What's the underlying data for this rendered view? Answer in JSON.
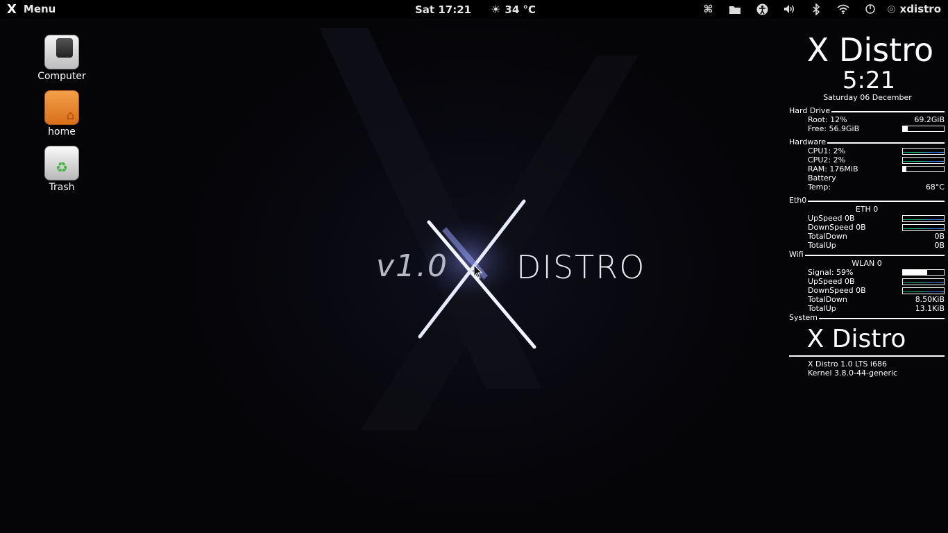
{
  "top_panel": {
    "menu_logo": "X",
    "menu_label": "Menu",
    "clock": "Sat 17:21",
    "weather": "34 °C",
    "user": "xdistro"
  },
  "desktop_icons": [
    {
      "label": "Computer"
    },
    {
      "label": "home"
    },
    {
      "label": "Trash"
    }
  ],
  "wallpaper": {
    "version_text": "v1.0",
    "distro_text": "DISTRO"
  },
  "conky": {
    "title": "X Distro",
    "time": "5:21",
    "date": "Saturday 06 December",
    "hard_drive": {
      "title": "Hard Drive",
      "root": "Root: 12%",
      "root_size": "69.2GiB",
      "free": "Free: 56.9GiB",
      "usage_percent": 12
    },
    "hardware": {
      "title": "Hardware",
      "cpu1": "CPU1: 2%",
      "cpu2": "CPU2: 2%",
      "ram": "RAM: 176MiB",
      "ram_percent": 9,
      "battery": "Battery",
      "temp_label": "Temp:",
      "temp_value": "68°C"
    },
    "eth0": {
      "title": "Eth0",
      "header": "ETH 0",
      "upspeed": "UpSpeed 0B",
      "downspeed": "DownSpeed 0B",
      "totaldown_label": "TotalDown",
      "totaldown_value": "0B",
      "totalup_label": "TotalUp",
      "totalup_value": "0B"
    },
    "wifi": {
      "title": "Wifi",
      "header": "WLAN 0",
      "signal": "Signal: 59%",
      "signal_percent": 59,
      "upspeed": "UpSpeed 0B",
      "downspeed": "DownSpeed 0B",
      "totaldown_label": "TotalDown",
      "totaldown_value": "8.50KiB",
      "totalup_label": "TotalUp",
      "totalup_value": "13.1KiB"
    },
    "system": {
      "title": "System",
      "name": "X Distro",
      "release": "X Distro 1.0 LTS i686",
      "kernel": "Kernel 3.8.0-44-generic"
    }
  }
}
